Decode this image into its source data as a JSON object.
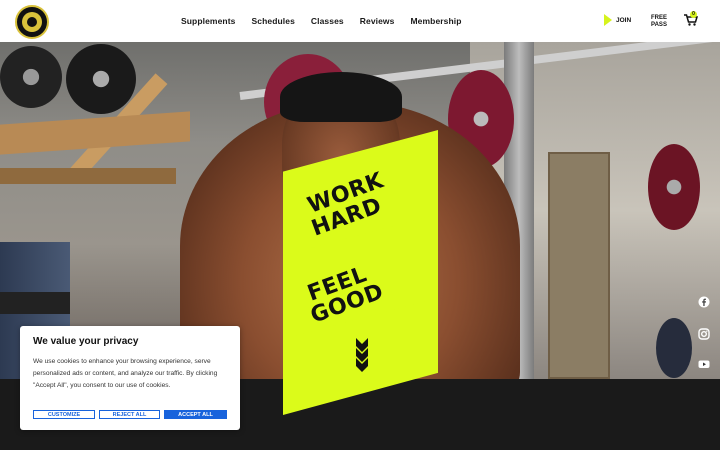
{
  "header": {
    "nav": [
      "Supplements",
      "Schedules",
      "Classes",
      "Reviews",
      "Membership"
    ],
    "join_label": "JOIN",
    "free_pass_line1": "FREE",
    "free_pass_line2": "PASS",
    "cart_count": "0"
  },
  "hero": {
    "line1a": "WORK",
    "line1b": "HARD",
    "line2a": "FEEL",
    "line2b": "GOOD",
    "accent_color": "#dbfb1a"
  },
  "social": [
    "facebook-icon",
    "instagram-icon",
    "youtube-icon"
  ],
  "privacy": {
    "title": "We value your privacy",
    "body": "We use cookies to enhance your browsing experience, serve personalized ads or content, and analyze our traffic. By clicking \"Accept All\", you consent to our use of cookies.",
    "customize": "CUSTOMIZE",
    "reject": "REJECT ALL",
    "accept": "ACCEPT ALL",
    "button_color": "#1863dc"
  }
}
